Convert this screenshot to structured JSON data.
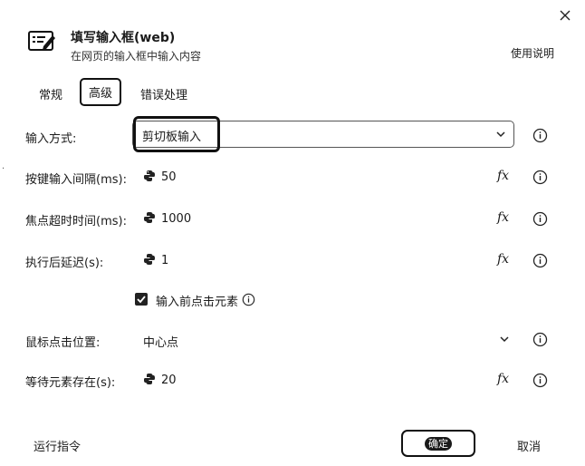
{
  "header": {
    "title": "填写输入框(web)",
    "subtitle": "在网页的输入框中输入内容",
    "help_label": "使用说明"
  },
  "tabs": [
    {
      "label": "常规",
      "active": false
    },
    {
      "label": "高级",
      "active": true
    },
    {
      "label": "错误处理",
      "active": false
    }
  ],
  "fields": {
    "input_method": {
      "label": "输入方式:",
      "value": "剪切板输入"
    },
    "key_interval": {
      "label": "按键输入间隔(ms):",
      "value": "50"
    },
    "focus_timeout": {
      "label": "焦点超时时间(ms):",
      "value": "1000"
    },
    "post_delay": {
      "label": "执行后延迟(s):",
      "value": "1"
    },
    "click_before": {
      "label": "输入前点击元素",
      "checked": true
    },
    "click_position": {
      "label": "鼠标点击位置:",
      "value": "中心点"
    },
    "wait_element": {
      "label": "等待元素存在(s):",
      "value": "20"
    }
  },
  "footer": {
    "run_label": "运行指令",
    "ok_label": "确定",
    "cancel_label": "取消"
  },
  "icons": {
    "fx": "fx",
    "python": "python-icon",
    "info": "info-icon"
  },
  "colors": {
    "text": "#1a1a1a",
    "border": "#111111",
    "background": "#ffffff"
  }
}
